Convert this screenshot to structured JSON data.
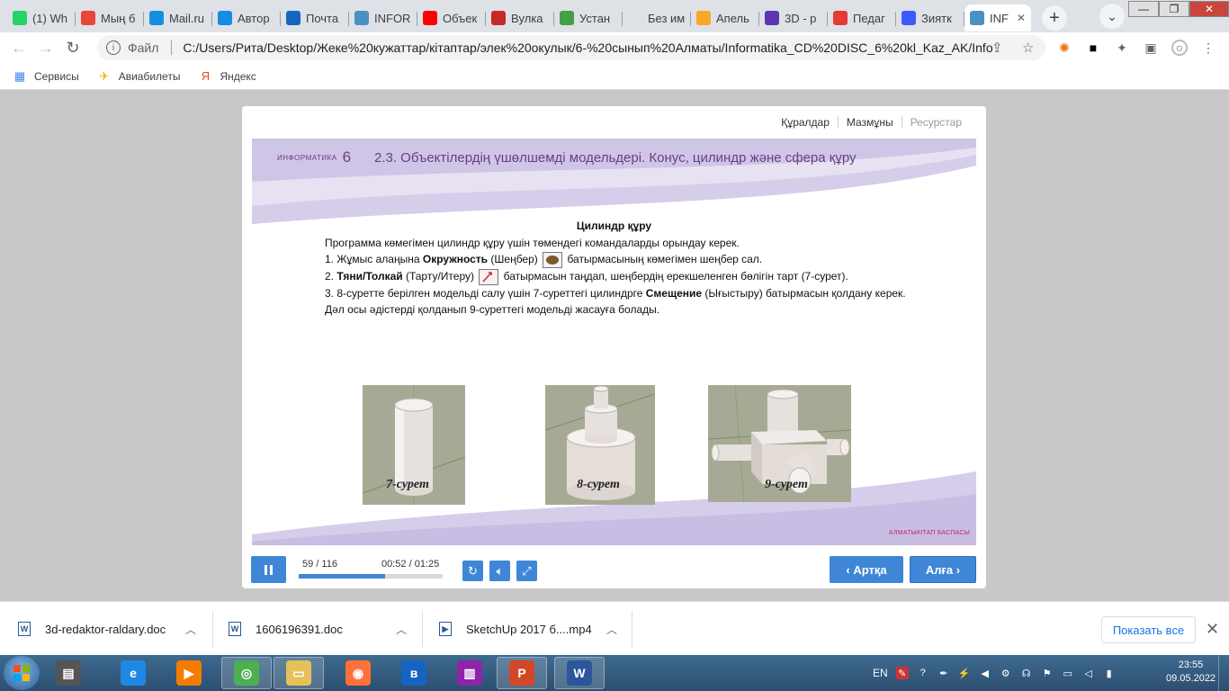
{
  "browser": {
    "tabs": [
      {
        "label": "(1) Wh",
        "icon": "whatsapp-icon",
        "color": "#25d366"
      },
      {
        "label": "Мың б",
        "icon": "grid-icon",
        "color": "#e8453c"
      },
      {
        "label": "Mail.ru",
        "icon": "at-icon",
        "color": "#168de2"
      },
      {
        "label": "Автор",
        "icon": "at-icon",
        "color": "#168de2"
      },
      {
        "label": "Почта",
        "icon": "mail-icon",
        "color": "#1565c0"
      },
      {
        "label": "INFOR",
        "icon": "page-icon",
        "color": "#4a90c2"
      },
      {
        "label": "Объек",
        "icon": "youtube-icon",
        "color": "#ff0000"
      },
      {
        "label": "Вулка",
        "icon": "vulkan-icon",
        "color": "#c62828"
      },
      {
        "label": "Устан",
        "icon": "download-icon",
        "color": "#43a047"
      },
      {
        "label": "Без им",
        "icon": "blank-icon",
        "color": "#dee1e6"
      },
      {
        "label": "Апель",
        "icon": "orange-icon",
        "color": "#f9a825"
      },
      {
        "label": "3D - р",
        "icon": "3d-icon",
        "color": "#5e35b1"
      },
      {
        "label": "Педаг",
        "icon": "flag-icon",
        "color": "#e53935"
      },
      {
        "label": "Зиятк",
        "icon": "u-icon",
        "color": "#3d5afe"
      },
      {
        "label": "INF",
        "icon": "page-icon",
        "color": "#4a90c2",
        "active": true
      }
    ],
    "address_label": "Файл",
    "url": "C:/Users/Рита/Desktop/Жеке%20кужаттар/кітаптар/элек%20окулык/6-%20сынып%20Алматы/Informatika_CD%20DISC_6%20kl_Kaz_AK/Infor...",
    "bookmarks": [
      {
        "label": "Сервисы",
        "icon": "apps-grid-icon"
      },
      {
        "label": "Авиабилеты",
        "icon": "airplane-icon"
      },
      {
        "label": "Яндекс",
        "icon": "yandex-icon"
      }
    ]
  },
  "player": {
    "nav": {
      "tools": "Құралдар",
      "contents": "Мазмұны",
      "resources": "Ресурстар"
    },
    "slide": {
      "brand": "ИНФОРМАТИКА",
      "grade": "6",
      "title": "2.3. Объектілердің үшөлшемді модельдері. Конус, цилиндр және сфера құру",
      "heading": "Цилиндр құру",
      "intro": "Программа көмегімен цилиндр құру үшін төмендегі командаларды орындау керек.",
      "step1_a": "1.    Жұмыс алаңына ",
      "step1_b": "Окружность",
      "step1_c": " (Шеңбер) ",
      "step1_d": " батырмасының көмегімен шеңбер сал.",
      "step2_a": "2. ",
      "step2_b": "Тяни/Толкай",
      "step2_c": " (Тарту/Итеру) ",
      "step2_d": " батырмасын таңдап, шеңбердің ерекшеленген бөлігін тарт (7-сурет).",
      "step3_a": "3. 8-суретте берілген модельді салу үшін 7-суреттегі цилиндрге ",
      "step3_b": "Смещение",
      "step3_c": " (Ығыстыру) батырмасын қолдану керек. Дәл осы әдістерді қолданып 9-суреттегі модельді жасауға болады.",
      "figures": [
        "7-сурет",
        "8-сурет",
        "9-сурет"
      ],
      "publisher": "АЛМАТЫКІТАП БАСПАСЫ"
    },
    "controls": {
      "slide_counter": "59 / 116",
      "time": "00:52 / 01:25",
      "progress": 0.6,
      "back_label": "Артқа",
      "next_label": "Алға"
    }
  },
  "downloads": {
    "items": [
      {
        "name": "3d-redaktor-raldary.doc",
        "icon": "word-doc-icon"
      },
      {
        "name": "1606196391.doc",
        "icon": "word-doc-icon"
      },
      {
        "name": "SketchUp 2017 б....mp4",
        "icon": "video-file-icon"
      }
    ],
    "show_all": "Показать все"
  },
  "taskbar": {
    "apps": [
      "scanner-icon",
      "ie-icon",
      "media-player-icon",
      "chrome-icon",
      "explorer-icon",
      "firefox-icon",
      "bluetooth-icon",
      "winrar-icon",
      "powerpoint-icon",
      "word-icon"
    ],
    "lang": "EN",
    "time": "23:55",
    "date": "09.05.2022"
  }
}
